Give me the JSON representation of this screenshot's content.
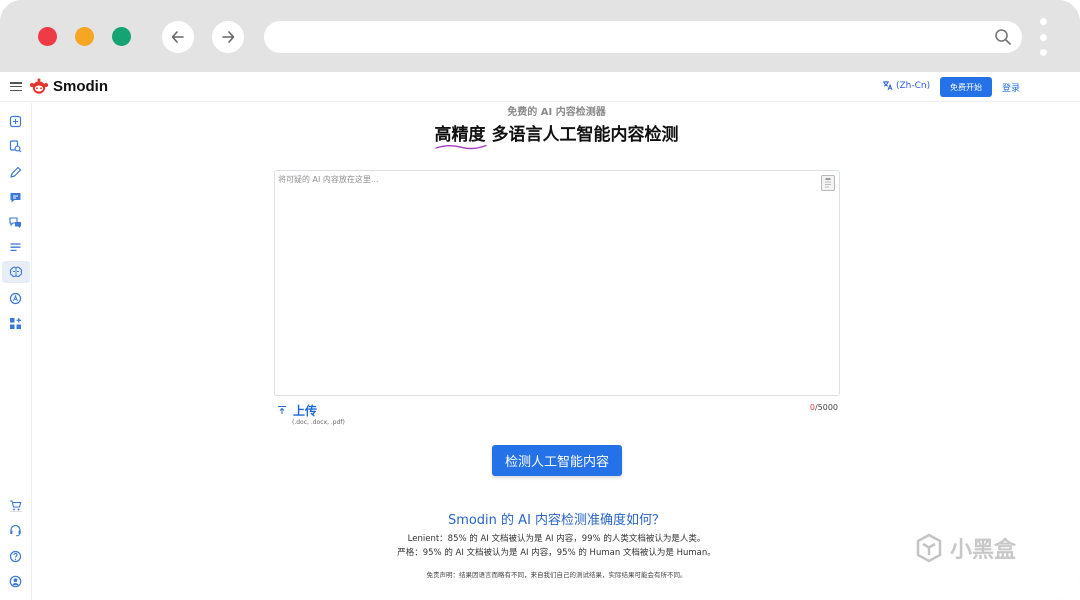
{
  "browser": {
    "address_value": "",
    "menu_icon": "kebab-menu-icon"
  },
  "header": {
    "brand": "Smodin",
    "lang_label": "(Zh-Cn)",
    "start_label": "免费开始",
    "login_label": "登录"
  },
  "sidebar": {
    "items": [
      {
        "icon": "rewriter-icon"
      },
      {
        "icon": "plagiarism-icon"
      },
      {
        "icon": "writer-pen-icon"
      },
      {
        "icon": "chat-icon"
      },
      {
        "icon": "translate-chat-icon"
      },
      {
        "icon": "summarizer-lines-icon"
      },
      {
        "icon": "ai-detector-brain-icon",
        "active": true
      },
      {
        "icon": "grader-icon"
      },
      {
        "icon": "more-apps-icon"
      }
    ],
    "bottom_items": [
      {
        "icon": "cart-icon"
      },
      {
        "icon": "support-headset-icon"
      },
      {
        "icon": "help-icon"
      },
      {
        "icon": "account-icon"
      }
    ]
  },
  "main": {
    "subtitle": "免费的 AI 内容检测器",
    "title_highlight": "高精度",
    "title_rest": " 多语言人工智能内容检测",
    "textarea_placeholder": "将可疑的 AI 内容放在这里...",
    "upload_label": "上传",
    "upload_types": "(.doc, .docx, .pdf)",
    "char_count": "0",
    "char_limit": "/5000",
    "detect_button": "检测人工智能内容",
    "accuracy_title": "Smodin 的 AI 内容检测准确度如何？",
    "accuracy_lenient": "Lenient：85% 的 AI 文档被认为是 AI 内容，99% 的人类文档被认为是人类。",
    "accuracy_strict": "严格：95% 的 AI 文档被认为是 AI 内容，95% 的 Human 文档被认为是 Human。",
    "disclaimer": "免责声明：结果因语言而略有不同，来自我们自己的测试结果，实际结果可能会有所不同。"
  },
  "watermark": {
    "text": "小黑盒"
  },
  "colors": {
    "accent": "#2471e8",
    "link": "#2a65c8",
    "counter_current": "#e0394b",
    "squiggle": "#a43dc6"
  }
}
